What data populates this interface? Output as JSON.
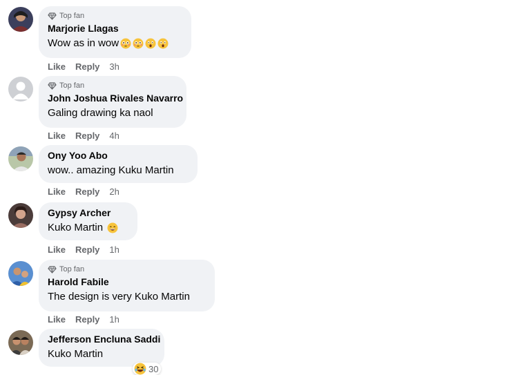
{
  "badge_label": "Top fan",
  "actions": {
    "like": "Like",
    "reply": "Reply"
  },
  "comments": [
    {
      "author": "Marjorie Llagas",
      "top_fan": true,
      "text": "Wow as in wow",
      "emojis": [
        "flushed-face-emoji",
        "flushed-face-emoji",
        "astonished-face-emoji",
        "astonished-face-emoji"
      ],
      "time": "3h"
    },
    {
      "author": "John Joshua Rivales Navarro",
      "top_fan": true,
      "text": "Galing drawing ka naol",
      "emojis": [],
      "time": "4h"
    },
    {
      "author": "Ony Yoo Abo",
      "top_fan": false,
      "text": "wow.. amazing Kuku Martin",
      "emojis": [],
      "time": "2h"
    },
    {
      "author": "Gypsy Archer",
      "top_fan": false,
      "text": "Kuko Martin ",
      "emojis": [
        "grinning-face-emoji"
      ],
      "time": "1h"
    },
    {
      "author": "Harold Fabile",
      "top_fan": true,
      "text": "The design is very Kuko Martin",
      "emojis": [],
      "time": "1h"
    },
    {
      "author": "Jefferson Encluna Saddi",
      "top_fan": false,
      "text": "Kuko Martin",
      "emojis": [],
      "time": ""
    }
  ],
  "reaction": {
    "icon": "laughing-face-emoji",
    "count": "30"
  },
  "colors": {
    "bubble": "#f0f2f5",
    "meta": "#65676b",
    "text": "#050505"
  }
}
